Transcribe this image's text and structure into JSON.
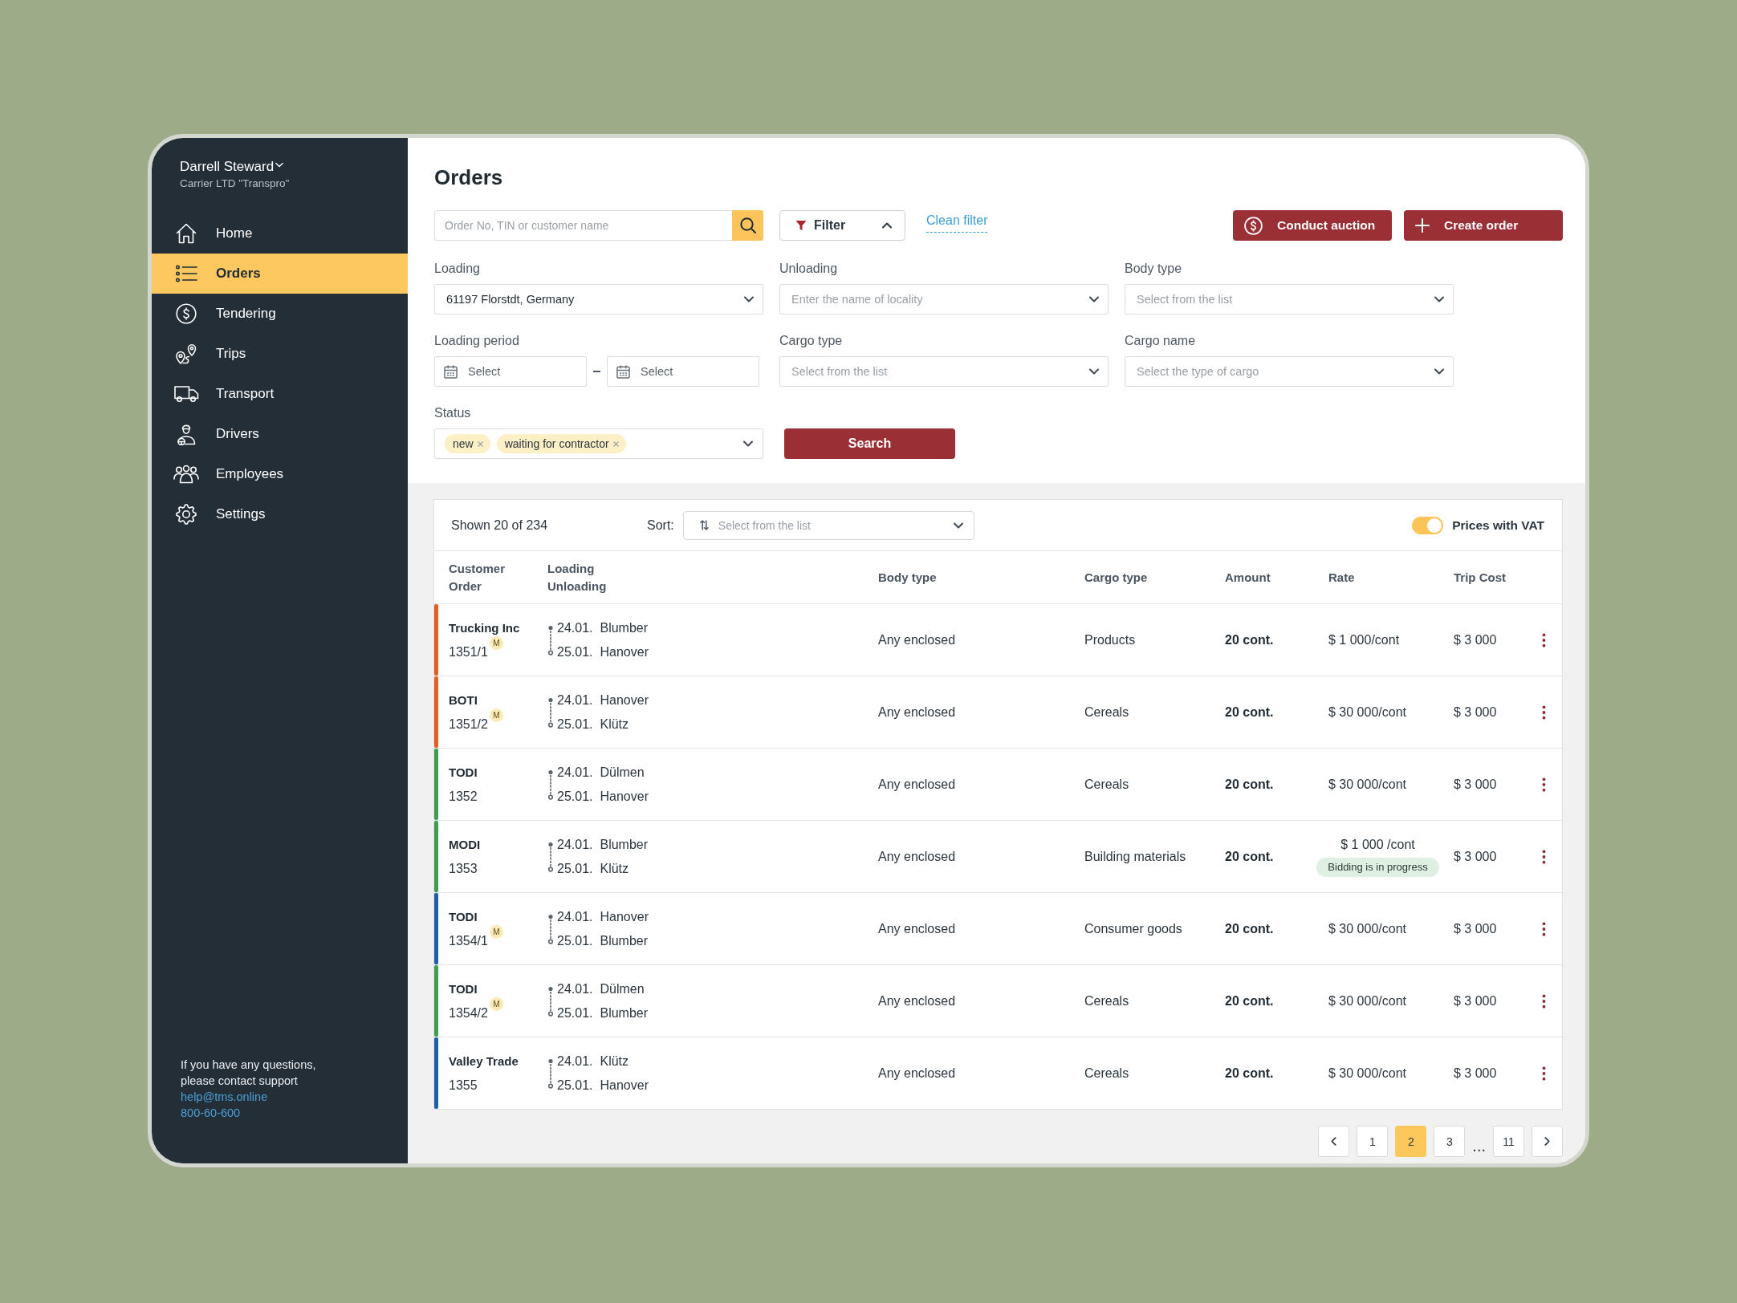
{
  "sidebar": {
    "user": {
      "name": "Darrell Steward",
      "company": "Carrier LTD \"Transpro\""
    },
    "items": [
      {
        "label": "Home",
        "selected": false
      },
      {
        "label": "Orders",
        "selected": true
      },
      {
        "label": "Tendering",
        "selected": false
      },
      {
        "label": "Trips",
        "selected": false
      },
      {
        "label": "Transport",
        "selected": false
      },
      {
        "label": "Drivers",
        "selected": false
      },
      {
        "label": "Employees",
        "selected": false
      },
      {
        "label": "Settings",
        "selected": false
      }
    ],
    "support": {
      "text": "If you have any questions, please contact support",
      "email": "help@tms.online",
      "phone": "800-60-600"
    }
  },
  "header": {
    "title": "Orders",
    "search": {
      "placeholder": "Order No, TIN or customer name"
    },
    "filter_button": {
      "label": "Filter",
      "expanded": true
    },
    "clean_filter": "Clean filter",
    "actions": [
      {
        "label": "Conduct auction"
      },
      {
        "label": "Create order"
      }
    ]
  },
  "filters": {
    "fields": [
      {
        "kind": "select",
        "label": "Loading",
        "value": "61197 Florstdt, Germany"
      },
      {
        "kind": "select",
        "label": "Unloading",
        "placeholder": "Enter the name of locality"
      },
      {
        "kind": "select",
        "label": "Body type",
        "placeholder": "Select from the list"
      },
      {
        "kind": "date_range",
        "label": "Loading period",
        "from": {
          "placeholder": "Select"
        },
        "to": {
          "placeholder": "Select"
        }
      },
      {
        "kind": "select",
        "label": "Cargo type",
        "placeholder": "Select from the list"
      },
      {
        "kind": "select",
        "label": "Cargo name",
        "placeholder": "Select the type of cargo"
      },
      {
        "kind": "tags",
        "label": "Status",
        "tags": [
          {
            "label": "new"
          },
          {
            "label": "waiting for contractor"
          }
        ]
      }
    ],
    "search_button": "Search"
  },
  "table": {
    "summary": "Shown 20 of 234",
    "sort": {
      "label": "Sort:",
      "placeholder": "Select from the list"
    },
    "vat_toggle": {
      "label": "Prices with VAT",
      "on": true
    },
    "columns": [
      {
        "label": "Customer",
        "sublabel": "Order"
      },
      {
        "label": "Loading",
        "sublabel": "Unloading"
      },
      {
        "label": "Body type"
      },
      {
        "label": "Cargo type"
      },
      {
        "label": "Amount"
      },
      {
        "label": "Rate"
      },
      {
        "label": "Trip Cost"
      }
    ],
    "rows": [
      {
        "color": "#e5601e",
        "customer": "Trucking Inc",
        "order": "1351/1",
        "badge": "M",
        "loading": {
          "date": "24.01.",
          "place": "Blumber"
        },
        "unloading": {
          "date": "25.01.",
          "place": "Hanover"
        },
        "body_type": "Any enclosed",
        "cargo_type": "Products",
        "amount": "20 cont.",
        "rate": "$ 1 000/cont",
        "trip_cost": "$ 3 000"
      },
      {
        "color": "#e5601e",
        "customer": "BOTI",
        "order": "1351/2",
        "badge": "M",
        "loading": {
          "date": "24.01.",
          "place": "Hanover"
        },
        "unloading": {
          "date": "25.01.",
          "place": "Klütz"
        },
        "body_type": "Any enclosed",
        "cargo_type": "Cereals",
        "amount": "20 cont.",
        "rate": "$ 30 000/cont",
        "trip_cost": "$ 3 000"
      },
      {
        "color": "#3f9d4f",
        "customer": "TODI",
        "order": "1352",
        "loading": {
          "date": "24.01.",
          "place": "Dülmen"
        },
        "unloading": {
          "date": "25.01.",
          "place": "Hanover"
        },
        "body_type": "Any enclosed",
        "cargo_type": "Cereals",
        "amount": "20 cont.",
        "rate": "$ 30 000/cont",
        "trip_cost": "$ 3 000"
      },
      {
        "color": "#3f9d4f",
        "customer": "MODI",
        "order": "1353",
        "loading": {
          "date": "24.01.",
          "place": "Blumber"
        },
        "unloading": {
          "date": "25.01.",
          "place": "Klütz"
        },
        "body_type": "Any enclosed",
        "cargo_type": "Building materials",
        "amount": "20 cont.",
        "rate": "$ 1 000 /cont",
        "rate_badge": "Bidding is in progress",
        "trip_cost": "$ 3 000"
      },
      {
        "color": "#1f5ea8",
        "customer": "TODI",
        "order": "1354/1",
        "badge": "M",
        "loading": {
          "date": "24.01.",
          "place": "Hanover"
        },
        "unloading": {
          "date": "25.01.",
          "place": "Blumber"
        },
        "body_type": "Any enclosed",
        "cargo_type": "Consumer goods",
        "amount": "20 cont.",
        "rate": "$ 30 000/cont",
        "trip_cost": "$ 3 000"
      },
      {
        "color": "#3f9d4f",
        "customer": "TODI",
        "order": "1354/2",
        "badge": "M",
        "loading": {
          "date": "24.01.",
          "place": "Dülmen"
        },
        "unloading": {
          "date": "25.01.",
          "place": "Blumber"
        },
        "body_type": "Any enclosed",
        "cargo_type": "Cereals",
        "amount": "20 cont.",
        "rate": "$ 30 000/cont",
        "trip_cost": "$ 3 000"
      },
      {
        "color": "#1f5ea8",
        "customer": "Valley Trade",
        "order": "1355",
        "loading": {
          "date": "24.01.",
          "place": "Klütz"
        },
        "unloading": {
          "date": "25.01.",
          "place": "Hanover"
        },
        "body_type": "Any enclosed",
        "cargo_type": "Cereals",
        "amount": "20 cont.",
        "rate": "$ 30 000/cont",
        "trip_cost": "$ 3 000"
      }
    ]
  },
  "pagination": {
    "items": [
      {
        "kind": "page",
        "label": "1",
        "selected": false
      },
      {
        "kind": "page",
        "label": "2",
        "selected": true
      },
      {
        "kind": "page",
        "label": "3",
        "selected": false
      },
      {
        "kind": "ellipsis",
        "label": "...",
        "selected": false
      },
      {
        "kind": "page",
        "label": "11",
        "selected": false
      }
    ]
  }
}
